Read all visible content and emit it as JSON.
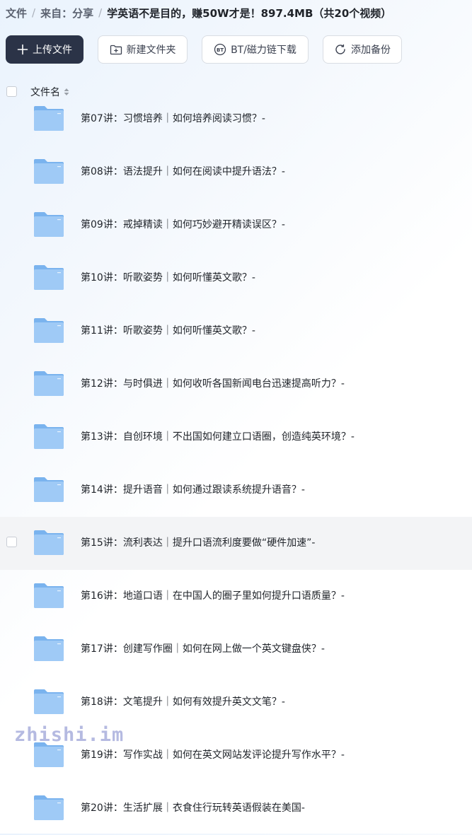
{
  "breadcrumb": {
    "items": [
      "文件",
      "来自：分享"
    ],
    "current": "学英语不是目的，赚50W才是！897.4MB（共20个视频）"
  },
  "toolbar": {
    "upload": "上传文件",
    "new_folder": "新建文件夹",
    "bt_download": "BT/磁力链下载",
    "add_backup": "添加备份"
  },
  "table": {
    "column_name": "文件名"
  },
  "files": [
    {
      "name": "第07讲：习惯培养｜如何培养阅读习惯？-"
    },
    {
      "name": "第08讲：语法提升｜如何在阅读中提升语法？-"
    },
    {
      "name": "第09讲：戒掉精读｜如何巧妙避开精读误区？-"
    },
    {
      "name": "第10讲：听歌姿势｜如何听懂英文歌？-"
    },
    {
      "name": "第11讲：听歌姿势｜如何听懂英文歌？-"
    },
    {
      "name": "第12讲：与时俱进｜如何收听各国新闻电台迅速提高听力？-"
    },
    {
      "name": "第13讲：自创环境｜不出国如何建立口语圈，创造纯英环境？-"
    },
    {
      "name": "第14讲：提升语音｜如何通过跟读系统提升语音？-"
    },
    {
      "name": "第15讲：流利表达｜提升口语流利度要做“硬件加速”-"
    },
    {
      "name": "第16讲：地道口语｜在中国人的圈子里如何提升口语质量？-"
    },
    {
      "name": "第17讲：创建写作圈｜如何在网上做一个英文键盘侠？-"
    },
    {
      "name": "第18讲：文笔提升｜如何有效提升英文文笔？-"
    },
    {
      "name": "第19讲：写作实战｜如何在英文网站发评论提升写作水平？-"
    },
    {
      "name": "第20讲：生活扩展｜衣食住行玩转英语假装在美国-"
    }
  ],
  "watermark": "zhishi.im",
  "colors": {
    "primary_button": "#2b3347",
    "folder_light": "#9fcaf6",
    "folder_dark": "#7ab3ee",
    "row_highlight": "#f3f4f6"
  }
}
